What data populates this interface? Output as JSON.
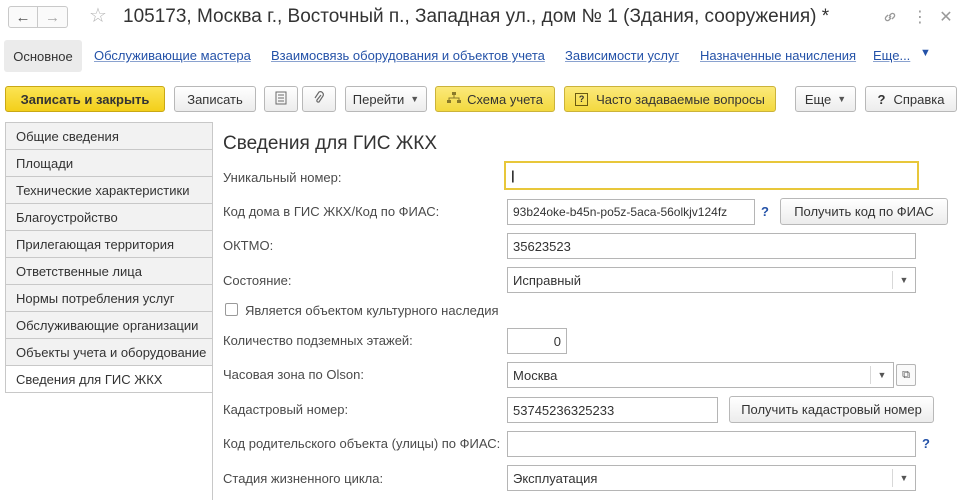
{
  "window": {
    "title": "105173, Москва г., Восточный п., Западная ул., дом № 1 (Здания, сооружения) *",
    "back_icon": "arrow-left",
    "forward_icon": "arrow-right",
    "favorite_icon": "star",
    "link_icon": "chain-link",
    "menu_icon": "vertical-dots",
    "close_icon": "close-x"
  },
  "tabs": {
    "main": "Основное",
    "links": [
      "Обслуживающие мастера",
      "Взаимосвязь оборудования и объектов учета",
      "Зависимости услуг",
      "Назначенные начисления",
      "Еще..."
    ]
  },
  "toolbar": {
    "save_close": "Записать и закрыть",
    "save": "Записать",
    "goto": "Перейти",
    "scheme": "Схема учета",
    "faq": "Часто задаваемые вопросы",
    "more": "Еще",
    "help": "Справка",
    "help_mark": "?"
  },
  "sidebar": {
    "items": [
      {
        "label": "Общие сведения"
      },
      {
        "label": "Площади"
      },
      {
        "label": "Технические характеристики"
      },
      {
        "label": "Благоустройство"
      },
      {
        "label": "Прилегающая территория"
      },
      {
        "label": "Ответственные лица"
      },
      {
        "label": "Нормы потребления услуг"
      },
      {
        "label": "Обслуживающие организации"
      },
      {
        "label": "Объекты учета и оборудование"
      },
      {
        "label": "Сведения для ГИС ЖКХ",
        "active": true
      }
    ]
  },
  "form": {
    "title": "Сведения для ГИС ЖКХ",
    "unique_number": {
      "label": "Уникальный номер:",
      "value": "|"
    },
    "house_code": {
      "label": "Код дома в ГИС ЖКХ/Код по ФИАС:",
      "value": "93b24oke-b45n-po5z-5aca-56olkjv124fz",
      "button": "Получить код по ФИАС",
      "help": "?"
    },
    "oktmo": {
      "label": "ОКТМО:",
      "value": "35623523"
    },
    "state": {
      "label": "Состояние:",
      "value": "Исправный"
    },
    "cultural": {
      "label": "Является объектом культурного наследия",
      "checked": false
    },
    "underground": {
      "label": "Количество подземных этажей:",
      "value": "0"
    },
    "timezone": {
      "label": "Часовая зона по Olson:",
      "value": "Москва"
    },
    "cadastral": {
      "label": "Кадастровый номер:",
      "value": "53745236325233",
      "button": "Получить кадастровый номер"
    },
    "parent_code": {
      "label": "Код родительского объекта (улицы) по ФИАС:",
      "value": "",
      "help": "?"
    },
    "lifecycle": {
      "label": "Стадия жизненного цикла:",
      "value": "Эксплуатация"
    }
  },
  "colors": {
    "accent_yellow": "#f3cf1a",
    "link_blue": "#2452a8",
    "focus_border": "#e8c73a"
  }
}
